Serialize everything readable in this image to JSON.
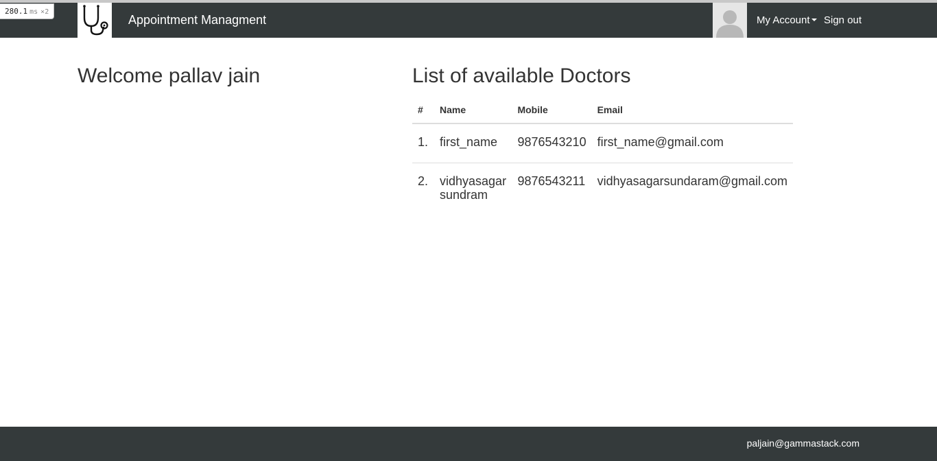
{
  "perf_badge": {
    "value": "280.1",
    "unit": "ms",
    "multiplier": "×2"
  },
  "navbar": {
    "logo_icon": "stethoscope-icon",
    "brand": "Appointment Managment",
    "avatar_icon": "user-silhouette-icon",
    "account_label": "My Account",
    "signout_label": "Sign out"
  },
  "main": {
    "welcome": "Welcome pallav jain",
    "doctors_title": "List of available Doctors",
    "table": {
      "headers": [
        "#",
        "Name",
        "Mobile",
        "Email"
      ],
      "rows": [
        {
          "index": "1.",
          "name": "first_name",
          "mobile": "9876543210",
          "email": "first_name@gmail.com"
        },
        {
          "index": "2.",
          "name": "vidhyasagar sundram",
          "mobile": "9876543211",
          "email": "vidhyasagarsundaram@gmail.com"
        }
      ]
    }
  },
  "footer": {
    "email": "paljain@gammastack.com"
  },
  "colors": {
    "navbar_bg": "#343a3b",
    "nav_text": "#ffffff",
    "body_text": "#333333"
  }
}
